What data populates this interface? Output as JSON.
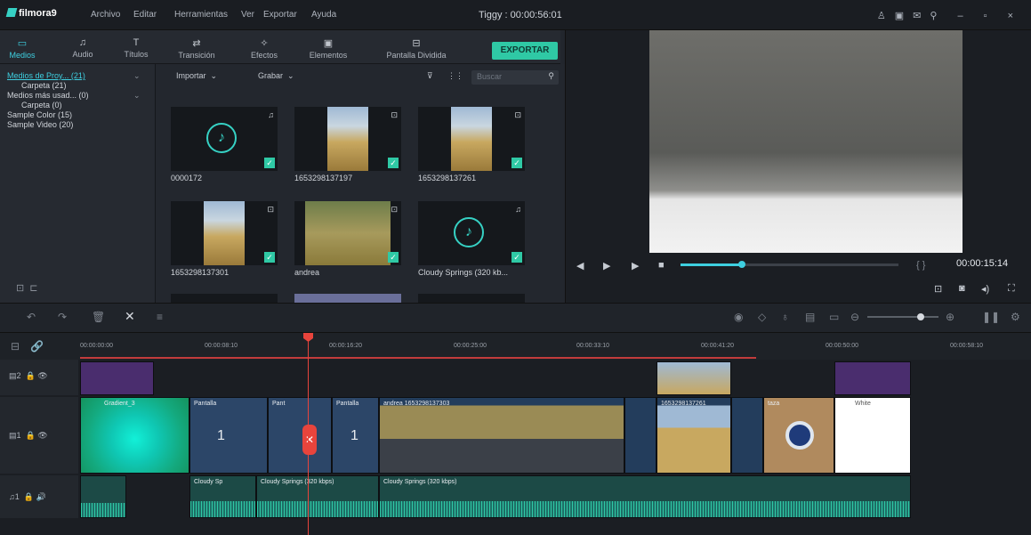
{
  "app": {
    "logo": "filmora9",
    "title": "Tiggy : 00:00:56:01"
  },
  "menu": [
    "Archivo",
    "Editar",
    "Herramientas",
    "Ver",
    "Exportar",
    "Ayuda"
  ],
  "tabs": [
    {
      "label": "Medios",
      "icon": "folder-icon"
    },
    {
      "label": "Audio",
      "icon": "music-icon"
    },
    {
      "label": "Títulos",
      "icon": "text-icon"
    },
    {
      "label": "Transición",
      "icon": "transition-icon"
    },
    {
      "label": "Efectos",
      "icon": "effects-icon"
    },
    {
      "label": "Elementos",
      "icon": "elements-icon"
    },
    {
      "label": "Pantalla Dividida",
      "icon": "split-screen-icon"
    }
  ],
  "export_label": "EXPORTAR",
  "tree": [
    {
      "label": "Medios de Proy... (21)",
      "selected": true
    },
    {
      "label": "Carpeta (21)"
    },
    {
      "label": "Medios más usad... (0)"
    },
    {
      "label": "Carpeta (0)"
    },
    {
      "label": "Sample Color (15)"
    },
    {
      "label": "Sample Video (20)"
    }
  ],
  "media_toolbar": {
    "import": "Importar",
    "record": "Grabar",
    "search_placeholder": "Buscar"
  },
  "media_items": [
    {
      "name": "0000172",
      "kind": "audio"
    },
    {
      "name": "1653298137197",
      "kind": "image"
    },
    {
      "name": "1653298137261",
      "kind": "image"
    },
    {
      "name": "1653298137301",
      "kind": "image"
    },
    {
      "name": "andrea",
      "kind": "image"
    },
    {
      "name": "Cloudy Springs (320 kb...",
      "kind": "audio"
    }
  ],
  "preview": {
    "timecode": "00:00:15:14",
    "progress": 0.28
  },
  "ruler": [
    "00:00:00:00",
    "00:00:08:10",
    "00:00:16:20",
    "00:00:25:00",
    "00:00:33:10",
    "00:00:41:20",
    "00:00:50:00",
    "00:00:58:10"
  ],
  "track_labels": {
    "t2": "2",
    "t1": "1",
    "a1": "1"
  },
  "clips": {
    "gradient": "Gradient_3",
    "split1": "Pantalla",
    "split2": "Pant",
    "split3": "Pantalla",
    "andrea": "andrea 1653298137303",
    "img2": "1653298137261",
    "taza": "taza",
    "white": "White",
    "audio1": "Cloudy Sp",
    "audio2": "Cloudy Springs (320 kbps)",
    "audio3": "Cloudy Springs (320 kbps)",
    "split_num": "1"
  },
  "colors": {
    "accent": "#3ecfe0",
    "export": "#2fc9a5",
    "playhead": "#e8443c",
    "title_clip": "#4a2d6e"
  }
}
